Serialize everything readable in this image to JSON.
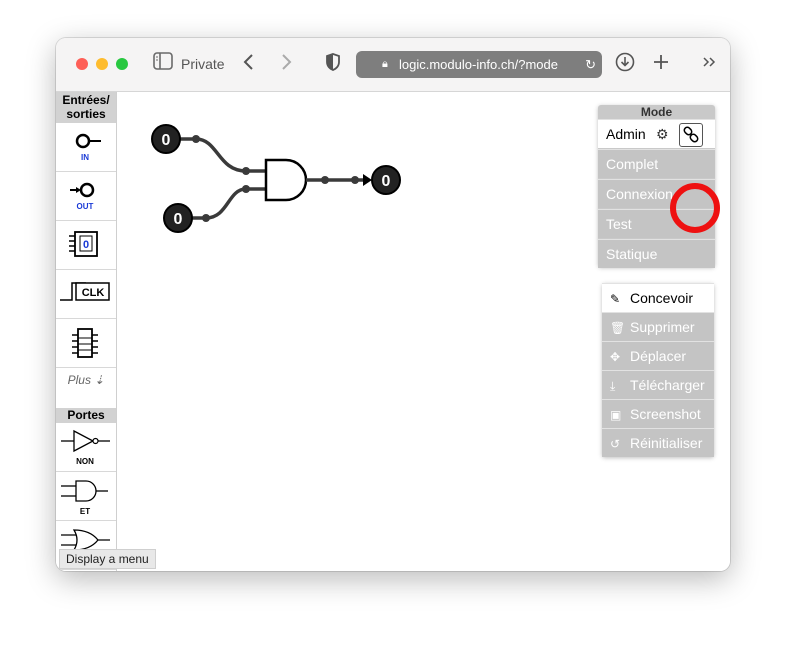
{
  "browser": {
    "private_label": "Private",
    "url": "logic.modulo-info.ch/?mode"
  },
  "palette": {
    "io_heading": "Entrées/ sorties",
    "in_label": "IN",
    "out_label": "OUT",
    "display_value": "0",
    "clk_label": "CLK",
    "more_label": "Plus ⇣",
    "gates_heading": "Portes",
    "not_label": "NON",
    "and_label": "ET"
  },
  "tooltip": "Display a menu",
  "circuit": {
    "input1_value": "0",
    "input2_value": "0",
    "output_value": "0"
  },
  "mode_panel": {
    "title": "Mode",
    "modes": [
      "Admin",
      "Complet",
      "Connexion",
      "Test",
      "Statique"
    ],
    "active": "Admin"
  },
  "actions_panel": {
    "actions": [
      "Concevoir",
      "Supprimer",
      "Déplacer",
      "Télécharger",
      "Screenshot",
      "Réinitialiser"
    ],
    "active": "Concevoir"
  },
  "colors": {
    "highlight_ring": "#ee1111",
    "wire": "#3a3a3a",
    "panel_bg": "#c4c4c4"
  }
}
